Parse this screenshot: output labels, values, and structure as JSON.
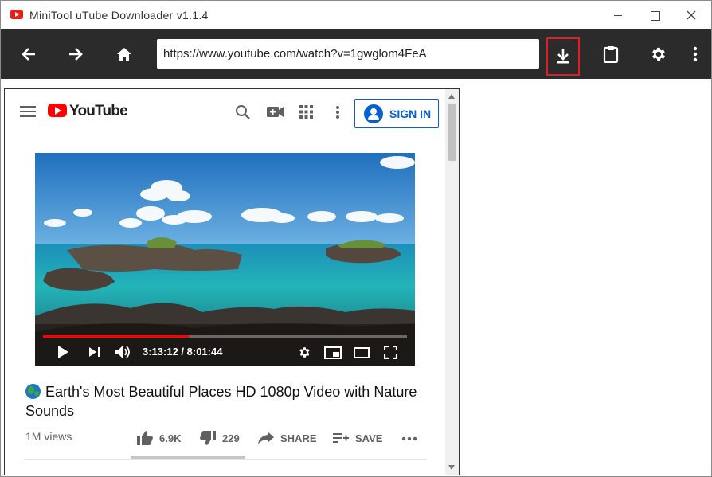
{
  "window": {
    "title": "MiniTool uTube Downloader v1.1.4"
  },
  "toolbar": {
    "url": "https://www.youtube.com/watch?v=1gwglom4FeA"
  },
  "youtube": {
    "logo_text": "YouTube",
    "sign_in_label": "SIGN IN",
    "video": {
      "time": "3:13:12 / 8:01:44",
      "progress": 0.4
    },
    "title": "Earth's Most Beautiful Places HD 1080p Video with Nature Sounds",
    "views": "1M views",
    "likes": "6.9K",
    "dislikes": "229",
    "share_label": "SHARE",
    "save_label": "SAVE"
  },
  "colors": {
    "toolbar_bg": "#2b2b2b",
    "accent_red": "#e02020",
    "yt_blue": "#065fd4",
    "yt_red": "#ff0000"
  }
}
